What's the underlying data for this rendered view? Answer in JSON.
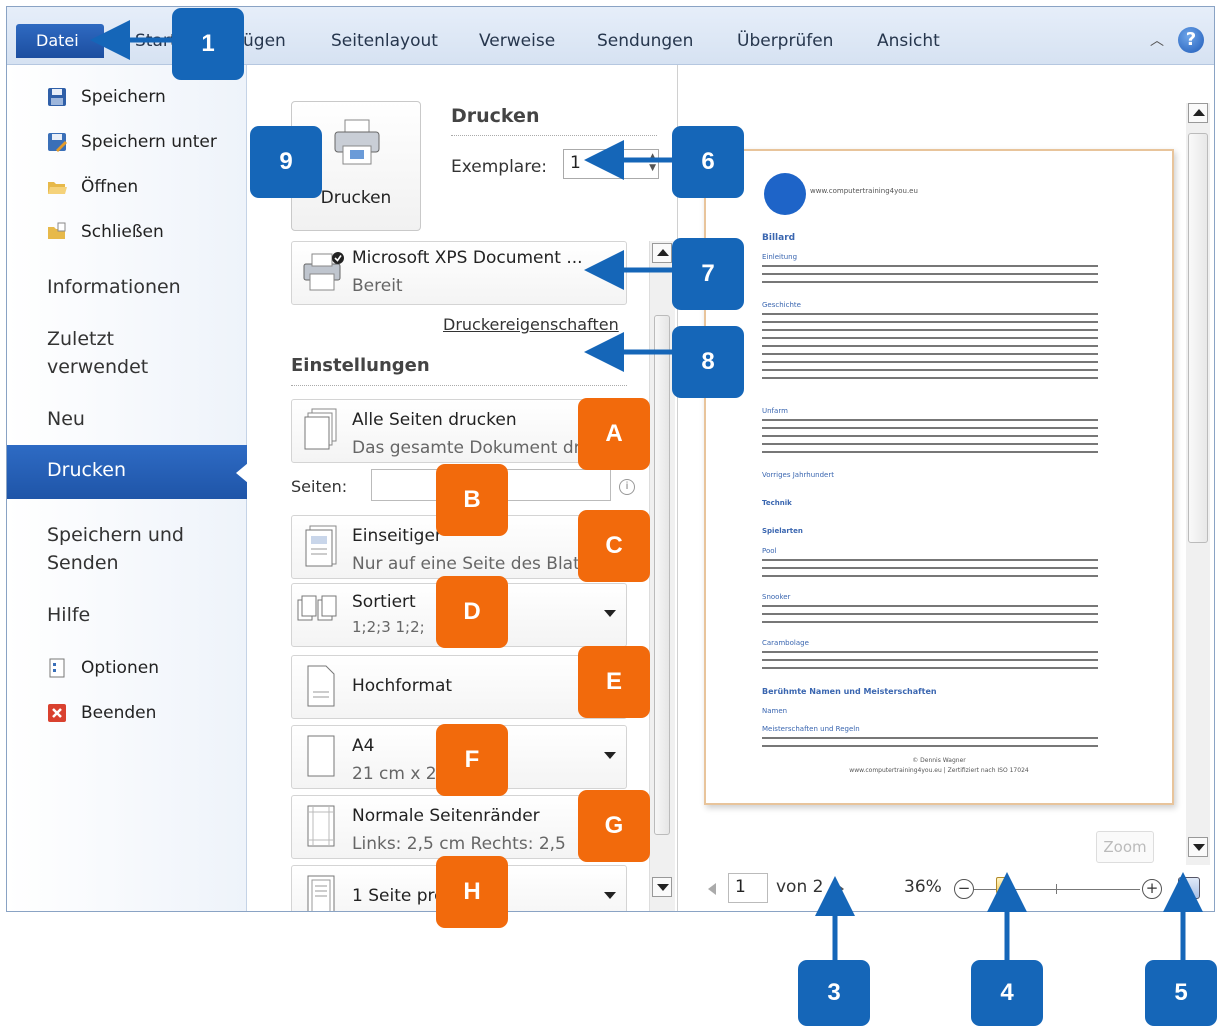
{
  "ribbon": {
    "file_tab": "Datei",
    "tabs": [
      "Start",
      "Einfügen",
      "Seitenlayout",
      "Verweise",
      "Sendungen",
      "Überprüfen",
      "Ansicht"
    ],
    "tab_visible": [
      "Start",
      "ügen",
      "Seitenlayout",
      "Verweise",
      "Sendungen",
      "Überprüfen",
      "Ansicht"
    ],
    "help": "?"
  },
  "nav": {
    "save": "Speichern",
    "save_as": "Speichern unter",
    "open": "Öffnen",
    "close": "Schließen",
    "info": "Informationen",
    "recent_1": "Zuletzt",
    "recent_2": "verwendet",
    "new": "Neu",
    "print": "Drucken",
    "send_1": "Speichern und",
    "send_2": "Senden",
    "help": "Hilfe",
    "options": "Optionen",
    "exit": "Beenden"
  },
  "print": {
    "button_label": "Drucken",
    "heading": "Drucken",
    "copies_label": "Exemplare:",
    "copies_value": "1",
    "printer_name": "Microsoft XPS Document ...",
    "printer_status": "Bereit",
    "printer_properties": "Druckereigenschaften",
    "settings_heading": "Einstellungen",
    "pages_label": "Seiten:",
    "info_icon": "i"
  },
  "settings": {
    "range_title": "Alle Seiten drucken",
    "range_sub": "Das gesamte Dokument dr",
    "sides_title": "Einseitiger",
    "sides_sub": "Nur auf eine Seite des Blatt",
    "collate_title": "Sortiert",
    "collate_sub": "1;2;3    1;2;",
    "orientation": "Hochformat",
    "paper_title": "A4",
    "paper_sub": "21  cm x 2",
    "margins_title": "Normale Seitenränder",
    "margins_sub": "Links: 2,5  cm    Rechts: 2,5",
    "per_sheet": "1 Seite pro"
  },
  "preview": {
    "logo_text": "www.computertraining4you.eu",
    "title": "Billard",
    "section_1": "Einleitung",
    "section_2": "Geschichte",
    "section_3": "Unfarm",
    "section_4": "Vorriges Jahrhundert",
    "section_5": "Technik",
    "section_6": "Spielarten",
    "sub_1": "Pool",
    "sub_2": "Snooker",
    "sub_3": "Carambolage",
    "section_7": "Berühmte Namen und Meisterschaften",
    "sub_4": "Namen",
    "sub_5": "Meisterschaften und Regeln",
    "footer_1": "© Dennis Wagner",
    "footer_2": "www.computertraining4you.eu | Zertifiziert nach ISO 17024",
    "zoom_button": "Zoom",
    "page_current": "1",
    "page_total": "von 2",
    "zoom_percent": "36%",
    "zoom_minus": "−",
    "zoom_plus": "+"
  },
  "callouts": [
    "1",
    "3",
    "4",
    "5",
    "6",
    "7",
    "8",
    "9"
  ],
  "tags": [
    "A",
    "B",
    "C",
    "D",
    "E",
    "F",
    "G",
    "H"
  ],
  "colors": {
    "callout": "#1566b8",
    "tag": "#f26a0c",
    "nav_selected": "#2466b8",
    "file_tab": "#2a62b8"
  }
}
